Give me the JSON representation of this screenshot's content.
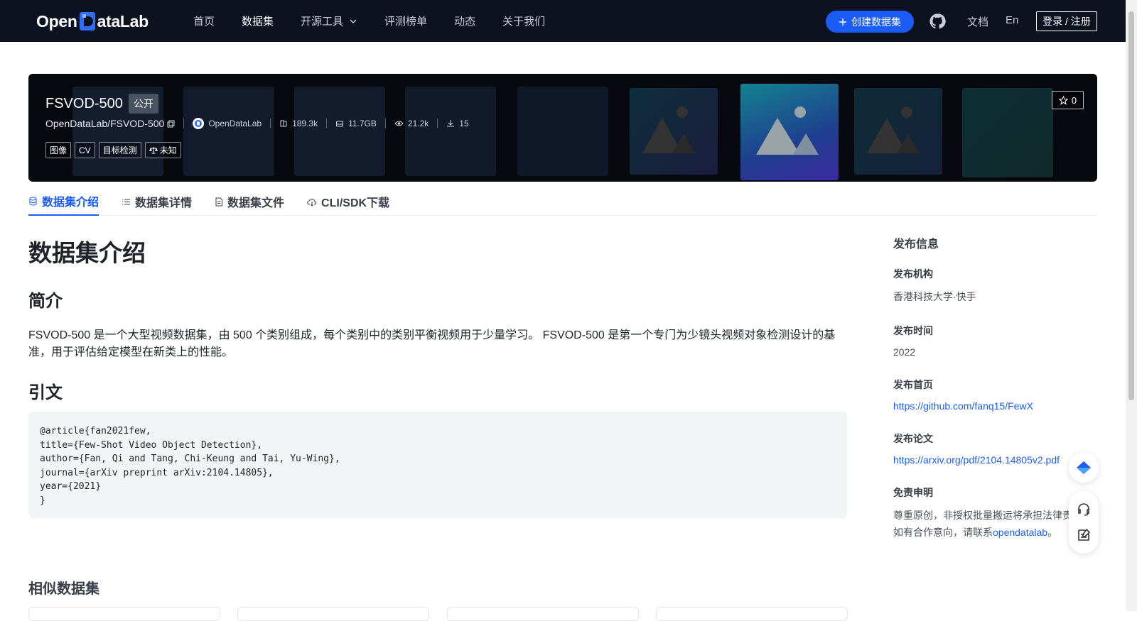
{
  "nav": {
    "logo_text_1": "Open",
    "logo_text_2": "ataLab",
    "items": [
      {
        "label": "首页"
      },
      {
        "label": "数据集"
      },
      {
        "label": "开源工具"
      },
      {
        "label": "评测榜单"
      },
      {
        "label": "动态"
      },
      {
        "label": "关于我们"
      }
    ],
    "create_label": "创建数据集",
    "docs_label": "文档",
    "lang_label": "En",
    "login_label": "登录 / 注册"
  },
  "dataset": {
    "name": "FSVOD-500",
    "visibility": "公开",
    "repo": "OpenDataLab/FSVOD-500",
    "org": "OpenDataLab",
    "files": "189.3k",
    "size": "11.7GB",
    "views": "21.2k",
    "downloads": "15",
    "tags": [
      "图像",
      "CV",
      "目标检测",
      "未知"
    ],
    "stars": "0"
  },
  "tabs": [
    {
      "label": "数据集介绍"
    },
    {
      "label": "数据集详情"
    },
    {
      "label": "数据集文件"
    },
    {
      "label": "CLI/SDK下载"
    }
  ],
  "main": {
    "title": "数据集介绍",
    "intro_heading": "简介",
    "intro_text": "FSVOD-500 是一个大型视频数据集，由 500 个类别组成，每个类别中的类别平衡视频用于少量学习。 FSVOD-500 是第一个专门为少镜头视频对象检测设计的基准，用于评估给定模型在新类上的性能。",
    "citation_heading": "引文",
    "citation": "@article{fan2021few,\ntitle={Few-Shot Video Object Detection},\nauthor={Fan, Qi and Tang, Chi-Keung and Tai, Yu-Wing},\njournal={arXiv preprint arXiv:2104.14805},\nyear={2021}\n}",
    "similar_heading": "相似数据集"
  },
  "sidebar": {
    "heading": "发布信息",
    "org_label": "发布机构",
    "org_value": "香港科技大学·快手",
    "time_label": "发布时间",
    "time_value": "2022",
    "home_label": "发布首页",
    "home_value": "https://github.com/fanq15/FewX",
    "paper_label": "发布论文",
    "paper_value": "https://arxiv.org/pdf/2104.14805v2.pdf",
    "disclaimer_label": "免责申明",
    "disclaimer_line1": "尊重原创，非授权批量搬运将承担法律责",
    "disclaimer_line2_pre": "如有合作意向，请联系",
    "disclaimer_link": "opendatalab",
    "disclaimer_end": "。"
  },
  "colors": {
    "accent": "#1a5cf5",
    "nav_bg": "#0c1220"
  }
}
